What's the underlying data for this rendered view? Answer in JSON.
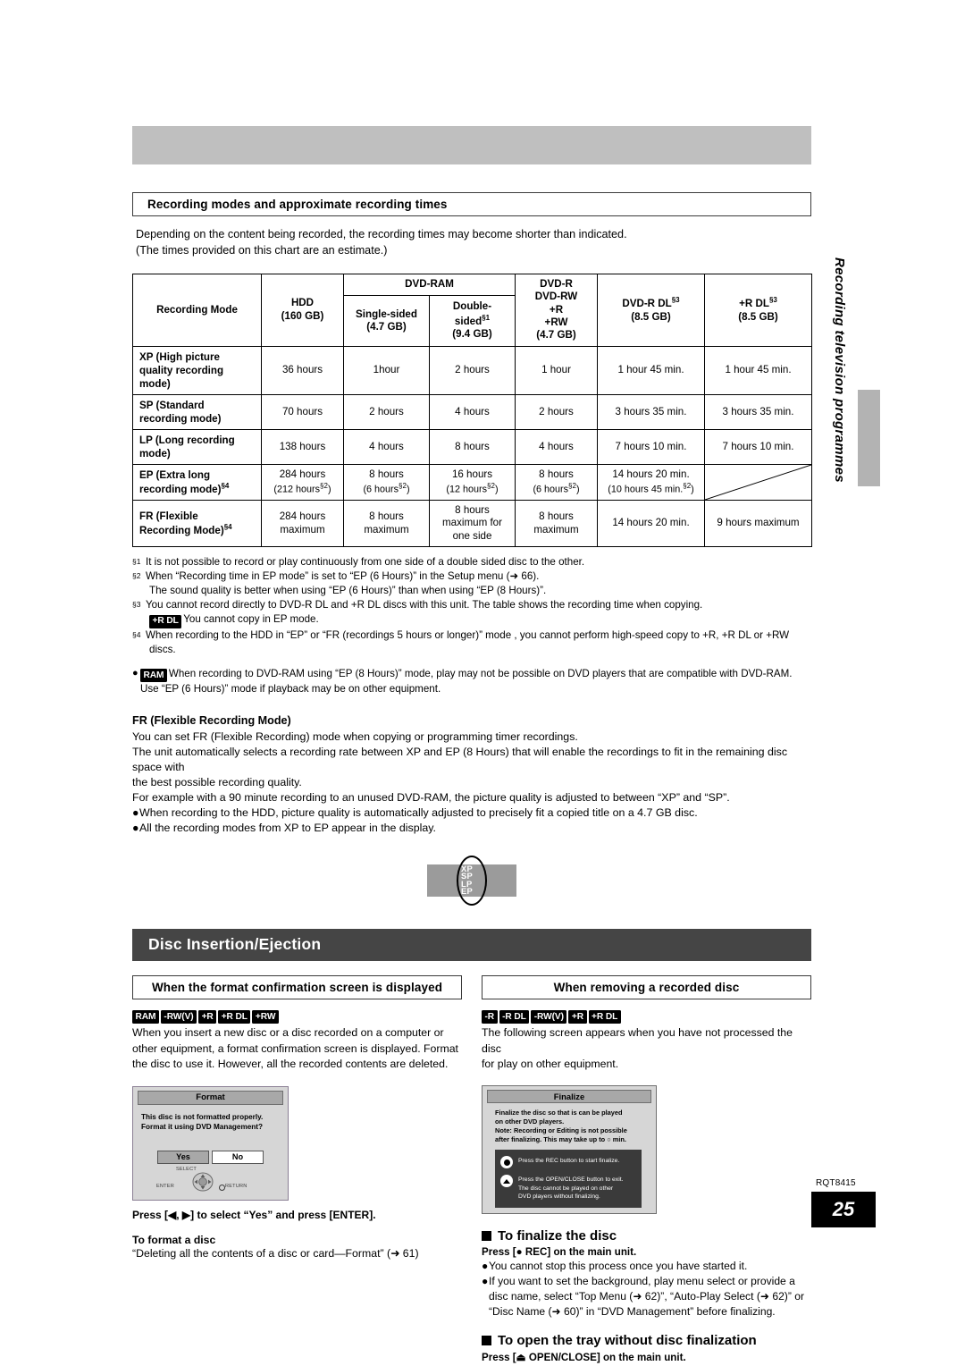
{
  "page": {
    "number": "25",
    "doc_code": "RQT8415",
    "side_tab_text": "Recording television programmes"
  },
  "section1": {
    "heading": "Recording modes and approximate recording times",
    "intro_line1": "Depending on the content being recorded, the recording times may become shorter than indicated.",
    "intro_line2": "(The times provided on this chart are an estimate.)"
  },
  "table": {
    "header": {
      "mode": "Recording Mode",
      "hdd_l1": "HDD",
      "hdd_l2": "(160 GB)",
      "dvdram": "DVD-RAM",
      "single_l1": "Single-sided",
      "single_l2": "(4.7 GB)",
      "double_l1": "Double-",
      "double_l2": "sided",
      "double_sup": "§1",
      "double_l3": "(9.4 GB)",
      "dvdr_l1": "DVD-R",
      "dvdr_l2": "DVD-RW",
      "dvdr_l3": "+R",
      "dvdr_l4": "+RW",
      "dvdr_l5": "(4.7 GB)",
      "dvdrdl_l1": "DVD-R DL",
      "dvdrdl_sup": "§3",
      "dvdrdl_l2": "(8.5 GB)",
      "rdl_l1": "+R DL",
      "rdl_sup": "§3",
      "rdl_l2": "(8.5 GB)"
    },
    "rows": [
      {
        "mode_l1": "XP (High picture",
        "mode_l2": "quality recording",
        "mode_l3": "mode)",
        "mode_sup": "",
        "hdd": "36 hours",
        "hdd2": "",
        "single": "1hour",
        "single2": "",
        "double": "2 hours",
        "double2": "",
        "double3": "",
        "dvdr": "1 hour",
        "dvdr2": "",
        "dvdrdl": "1 hour 45 min.",
        "dvdrdl2": "",
        "rdl": "1 hour 45 min."
      },
      {
        "mode_l1": "SP (Standard",
        "mode_l2": "recording mode)",
        "mode_l3": "",
        "mode_sup": "",
        "hdd": "70 hours",
        "hdd2": "",
        "single": "2 hours",
        "single2": "",
        "double": "4 hours",
        "double2": "",
        "double3": "",
        "dvdr": "2 hours",
        "dvdr2": "",
        "dvdrdl": "3 hours 35 min.",
        "dvdrdl2": "",
        "rdl": "3 hours 35 min."
      },
      {
        "mode_l1": "LP (Long recording",
        "mode_l2": "mode)",
        "mode_l3": "",
        "mode_sup": "",
        "hdd": "138 hours",
        "hdd2": "",
        "single": "4 hours",
        "single2": "",
        "double": "8 hours",
        "double2": "",
        "double3": "",
        "dvdr": "4 hours",
        "dvdr2": "",
        "dvdrdl": "7 hours 10 min.",
        "dvdrdl2": "",
        "rdl": "7 hours 10 min."
      },
      {
        "mode_l1": "EP (Extra long",
        "mode_l2": "recording mode)",
        "mode_l3": "",
        "mode_sup": "§4",
        "hdd": "284 hours",
        "hdd2": "(212 hours",
        "hdd2_sup": "§2",
        "hdd2_end": ")",
        "single": "8 hours",
        "single2": "(6 hours",
        "single2_sup": "§2",
        "single2_end": ")",
        "double": "16 hours",
        "double2": "(12 hours",
        "double2_sup": "§2",
        "double2_end": ")",
        "double3": "",
        "dvdr": "8 hours",
        "dvdr2": "(6 hours",
        "dvdr2_sup": "§2",
        "dvdr2_end": ")",
        "dvdrdl": "14 hours 20 min.",
        "dvdrdl2": "(10 hours 45 min.",
        "dvdrdl2_sup": "§2",
        "dvdrdl2_end": ")",
        "rdl": ""
      },
      {
        "mode_l1": "FR (Flexible",
        "mode_l2": "Recording Mode)",
        "mode_l3": "",
        "mode_sup": "§4",
        "hdd": "284 hours",
        "hdd2": "maximum",
        "single": "8 hours",
        "single2": "maximum",
        "double": "8 hours",
        "double2": "maximum for",
        "double3": "one side",
        "dvdr": "8 hours",
        "dvdr2": "maximum",
        "dvdrdl": "14 hours 20 min.",
        "dvdrdl2": "",
        "rdl": "9 hours maximum"
      }
    ]
  },
  "footnotes": [
    {
      "mark": "§1",
      "text": "It is not possible to record or play continuously from one side of a double sided disc to the other.",
      "cont": ""
    },
    {
      "mark": "§2",
      "text": "When “Recording time in EP mode” is set to “EP (6 Hours)” in the Setup menu (➜ 66).",
      "cont": "The sound quality is better when using “EP (6 Hours)” than when using “EP (8 Hours)”."
    },
    {
      "mark": "§3",
      "text": "You cannot record directly to DVD-R DL and +R DL discs with this unit. The table shows the recording time when copying.",
      "cont_chip": "+R DL",
      "cont": "You cannot copy in EP mode."
    },
    {
      "mark": "§4",
      "text": "When recording to the HDD in “EP” or “FR (recordings 5 hours or longer)” mode , you cannot perform high-speed copy to +R, +R DL or +RW",
      "cont": "discs."
    }
  ],
  "ram_note": {
    "chip": "RAM",
    "line1": "When recording to DVD-RAM using “EP (8 Hours)” mode, play may not be possible on DVD players that are compatible with DVD-RAM.",
    "line2": "Use “EP (6 Hours)” mode if playback may be on other equipment."
  },
  "fr_section": {
    "title": "FR (Flexible Recording Mode)",
    "p1": "You can set FR (Flexible Recording) mode when copying or programming timer recordings.",
    "p2": "The unit automatically selects a recording rate between XP and EP (8 Hours) that will enable the recordings to fit in the remaining disc space with",
    "p3": "the best possible recording quality.",
    "p4": "For example with a 90 minute recording to an unused DVD-RAM, the picture quality is adjusted to between “XP” and “SP”.",
    "b1": "When recording to the HDD, picture quality is automatically adjusted to precisely fit a copied title on a 4.7 GB disc.",
    "b2": "All the recording modes from XP to EP appear in the display."
  },
  "display_figure": {
    "modes": [
      "XP",
      "SP",
      "LP",
      "EP"
    ]
  },
  "section2": {
    "bar_title": "Disc Insertion/Ejection"
  },
  "left_col": {
    "heading": "When the format confirmation screen is displayed",
    "badges": [
      "RAM",
      "-RW(V)",
      "+R",
      "+R DL",
      "+RW"
    ],
    "body_l1": "When you insert a new disc or a disc recorded on a computer or",
    "body_l2": "other equipment, a format confirmation screen is displayed. Format",
    "body_l3": "the disc to use it. However, all the recorded contents are deleted.",
    "osd": {
      "title": "Format",
      "line1": "This disc is not formatted properly.",
      "line2": "Format it using DVD Management?",
      "yes": "Yes",
      "no": "No",
      "select": "SELECT",
      "enter": "ENTER",
      "return": "RETURN"
    },
    "press_line": "Press [◀, ▶] to select “Yes” and press [ENTER].",
    "sub_title": "To format a disc",
    "sub_body": "“Deleting all the contents of a disc or card—Format” (➜ 61)"
  },
  "right_col": {
    "heading": "When removing a recorded disc",
    "badges": [
      "-R",
      "-R DL",
      "-RW(V)",
      "+R",
      "+R DL"
    ],
    "body_l1": "The following screen appears when you have not processed the disc",
    "body_l2": "for play on other equipment.",
    "osd": {
      "title": "Finalize",
      "line1": "Finalize the disc so that is can be played",
      "line2": "on other DVD players.",
      "line3": "Note: Recording or Editing is not possible",
      "line4": "after finalizing. This may take up to ○ min.",
      "rec_text": "Press the REC button to start finalize.",
      "eject_l1": "Press the OPEN/CLOSE button to exit.",
      "eject_l2": "The disc cannot be played on other",
      "eject_l3": "DVD players without finalizing."
    },
    "finalize_head": "To finalize the disc",
    "finalize_sub": "Press [● REC] on the main unit.",
    "finalize_b1": "You cannot stop this process once you have started it.",
    "finalize_b2": "If you want to set the background, play menu select or provide a",
    "finalize_b2b": "disc name, select “Top Menu (➜ 62)”, “Auto-Play Select (➜ 62)” or",
    "finalize_b2c": "“Disc Name (➜ 60)” in “DVD Management” before finalizing.",
    "tray_head": "To open the tray without disc finalization",
    "tray_sub": "Press [⏏ OPEN/CLOSE] on the main unit."
  }
}
